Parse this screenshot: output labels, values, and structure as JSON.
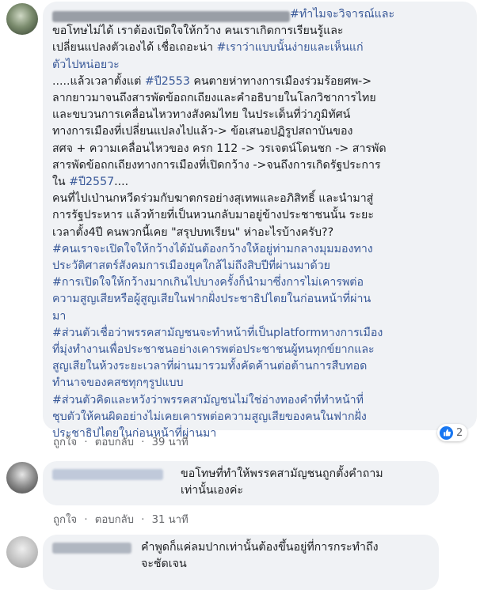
{
  "comments": [
    {
      "text_lines": [
        [
          {
            "t": "#ทำไมจะวิจารณ์และ",
            "h": true
          }
        ],
        [
          {
            "t": "ขอโทษไม่ได้ เราต้องเปิดใจให้กว้าง คนเราเกิดการเรียนรู้และ"
          }
        ],
        [
          {
            "t": "เปลี่ยนแปลงตัวเองได้ เชื่อเถอะน่า "
          },
          {
            "t": "#เราว่าแบบนั้นง่ายและเห็นแก่",
            "h": true
          }
        ],
        [
          {
            "t": "ตัวไปหน่อยวะ",
            "h": true
          }
        ],
        [
          {
            "t": "     .....แล้วเวลาตั้งแต่ "
          },
          {
            "t": "#ปี2553",
            "h": true
          },
          {
            "t": " คนตายห่าทางการเมืองร่วมร้อยศพ->"
          }
        ],
        [
          {
            "t": "ลากยาวมาจนถึงสารพัดข้อถกเถียงและคำอธิบายในโลกวิชาการไทย"
          }
        ],
        [
          {
            "t": "และขบวนการเคลื่อนไหวทางสังคมไทย ในประเด็นที่ว่าภูมิทัศน์"
          }
        ],
        [
          {
            "t": "ทางการเมืองที่เปลี่ยนแปลงไปแล้ว-> ข้อเสนอปฏิรูปสถาบันของ"
          }
        ],
        [
          {
            "t": "สศจ + ความเคลื่อนไหวของ ครก 112 -> วรเจตน์โดนชก -> สารพัด"
          }
        ],
        [
          {
            "t": "สารพัดข้อถกเถียงทางการเมืองที่เปิดกว้าง ->จนถึงการเกิดรัฐประการ"
          }
        ],
        [
          {
            "t": "ใน "
          },
          {
            "t": "#ปี2557",
            "h": true
          },
          {
            "t": "...."
          }
        ],
        [
          {
            "t": "คนที่ไปเป่านกหวีดร่วมกับฆาตกรอย่างสุเทพและอภิสิทธิ์ และนำมาสู่"
          }
        ],
        [
          {
            "t": "การรัฐประหาร แล้วท้ายที่เป็นหวนกลับมาอยู่ข้างประชาชนนั้น ระยะ"
          }
        ],
        [
          {
            "t": "เวลาตั้ง4ปี คนพวกนี้เคย \"สรุปบทเรียน\" ห่าอะไรบ้างครับ??"
          }
        ],
        [
          {
            "t": "#คนเราจะเปิดใจให้กว้างได้มันต้องกว้างให้อยู่ท่ามกลางมุมมองทาง",
            "h": true
          }
        ],
        [
          {
            "t": "ประวัติศาสตร์สังคมการเมืองยุคใกล้ไม่ถึงสิบปีที่ผ่านมาด้วย",
            "h": true
          }
        ],
        [
          {
            "t": "#การเปิดใจให้กว้างมากเกินไปบางครั้งก็นำมาซึ่งการไม่เคารพต่อ",
            "h": true
          }
        ],
        [
          {
            "t": "ความสูญเสียหรือผู้สูญเสียในฟากฝั่งประชาธิปไตยในก่อนหน้าที่ผ่าน",
            "h": true
          }
        ],
        [
          {
            "t": "มา",
            "h": true
          }
        ],
        [
          {
            "t": "#ส่วนตัวเชื่อว่าพรรคสามัญชนจะทำหน้าที่เป็นplatformทางการเมือง",
            "h": true
          }
        ],
        [
          {
            "t": "ที่มุ่งทำงานเพื่อประชาชนอย่างเคารพต่อประชาชนผู้ทนทุกข์ยากและ",
            "h": true
          }
        ],
        [
          {
            "t": "สูญเสียในห้วงระยะเวลาที่ผ่านมารวมทั้งคัดค้านต่อต้านการสืบทอด",
            "h": true
          }
        ],
        [
          {
            "t": "ทำนาจของคสชทุกๆรูปแบบ",
            "h": true
          }
        ],
        [
          {
            "t": "#ส่วนตัวคิดและหวังว่าพรรคสามัญชนไม่ใช่อ่างทองคำที่ทำหน้าที่",
            "h": true
          }
        ],
        [
          {
            "t": "ชุบตัวให้คนผิดอย่างไม่เคยเคารพต่อความสูญเสียของคนในฟากฝั่ง",
            "h": true
          }
        ],
        [
          {
            "t": "ประชาธิปไตยในก่อนหน้าที่ผ่านมา",
            "h": true
          }
        ]
      ],
      "actions": {
        "like": "ถูกใจ",
        "sep": "·",
        "reply": "ตอบกลับ",
        "time": "39 นาที"
      },
      "reaction_count": "2"
    },
    {
      "text_lines": [
        [
          {
            "t": "ขอโทษที่ทำให้พรรคสามัญชนถูกตั้งคำถาม"
          }
        ],
        [
          {
            "t": "เท่านั้นเองค่ะ"
          }
        ]
      ],
      "actions": {
        "like": "ถูกใจ",
        "sep": "·",
        "reply": "ตอบกลับ",
        "time": "31 นาที"
      },
      "reaction_count": ""
    },
    {
      "text_lines": [
        [
          {
            "t": "คำพูดก็แค่ลมปากเท่านั้นต้องขึ้นอยู่ที่การกระทำถึง"
          }
        ],
        [
          {
            "t": "จะชัดเจน"
          }
        ]
      ]
    }
  ],
  "colors": {
    "bubble": "#f0f2f5",
    "hashtag": "#385898",
    "like_blue": "#1877f2",
    "meta": "#65676b"
  },
  "icons": {
    "like": "thumbs-up-icon"
  }
}
